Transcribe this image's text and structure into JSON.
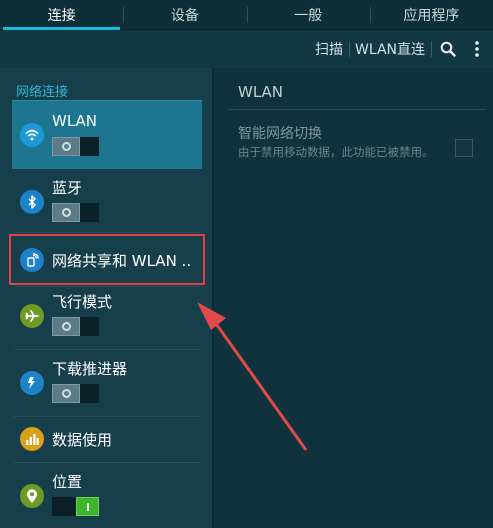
{
  "tabs": [
    {
      "label": "连接"
    },
    {
      "label": "设备"
    },
    {
      "label": "一般"
    },
    {
      "label": "应用程序"
    }
  ],
  "actionbar": {
    "scan_label": "扫描",
    "wlan_direct_label": "WLAN直连",
    "search_icon": "search-icon",
    "more_icon": "more-vert-icon"
  },
  "sidebar": {
    "section_header": "网络连接",
    "items": [
      {
        "label": "WLAN",
        "icon": "wifi-icon",
        "toggle": "off",
        "selected": true
      },
      {
        "label": "蓝牙",
        "icon": "bluetooth-icon",
        "toggle": "off"
      },
      {
        "label": "网络共享和 WLAN ..",
        "icon": "tethering-icon"
      },
      {
        "label": "飞行模式",
        "icon": "airplane-icon",
        "toggle": "off"
      },
      {
        "label": "下载推进器",
        "icon": "download-booster-icon",
        "toggle": "off"
      },
      {
        "label": "数据使用",
        "icon": "data-usage-icon"
      },
      {
        "label": "位置",
        "icon": "location-icon",
        "toggle": "on"
      }
    ]
  },
  "detail": {
    "title": "WLAN",
    "smart_switch_title": "智能网络切换",
    "smart_switch_desc": "由于禁用移动数据，此功能已被禁用。"
  },
  "colors": {
    "accent": "#19b7d8",
    "highlight": "#e04040",
    "toggle_on": "#3fb52a"
  }
}
